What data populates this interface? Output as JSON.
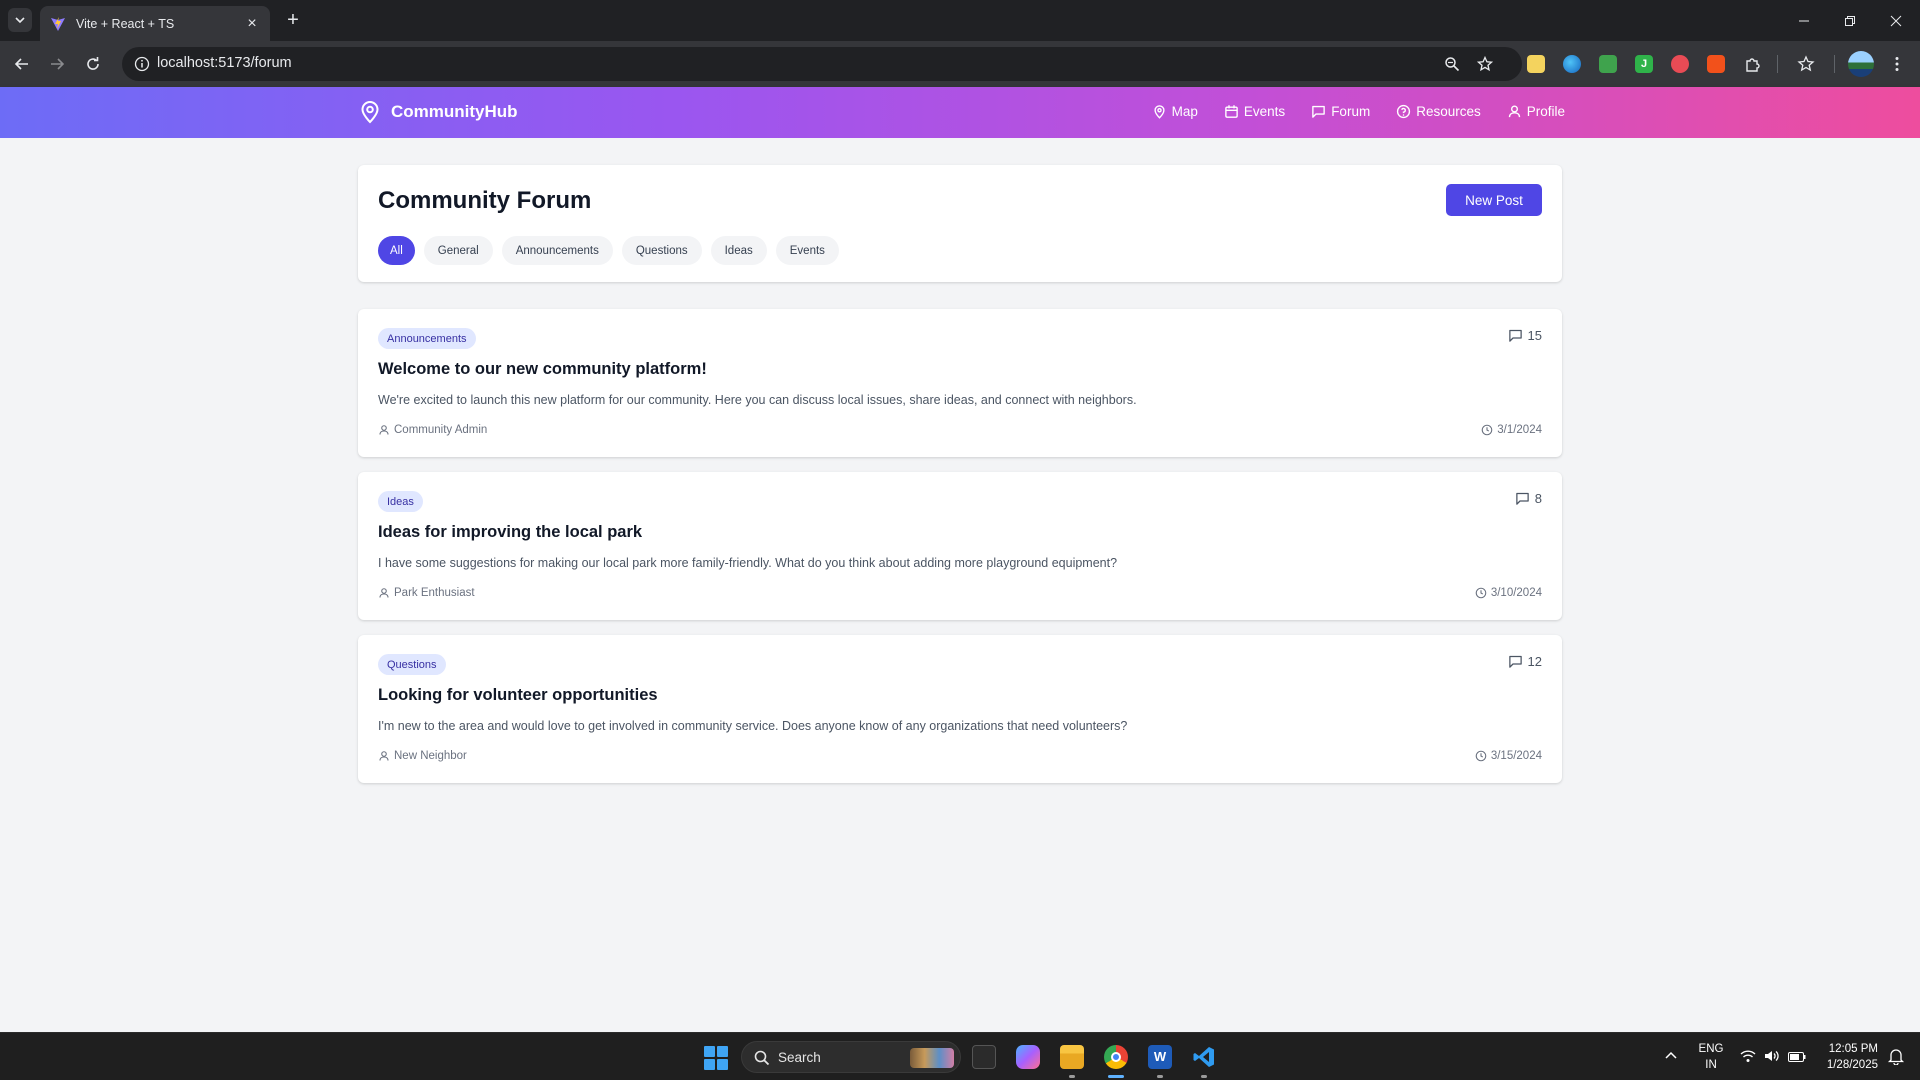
{
  "browser": {
    "tab_title": "Vite + React + TS",
    "url": "localhost:5173/forum"
  },
  "header": {
    "brand": "CommunityHub",
    "nav": [
      {
        "label": "Map",
        "icon": "map-pin-icon"
      },
      {
        "label": "Events",
        "icon": "calendar-icon"
      },
      {
        "label": "Forum",
        "icon": "message-square-icon"
      },
      {
        "label": "Resources",
        "icon": "help-circle-icon"
      },
      {
        "label": "Profile",
        "icon": "user-icon"
      }
    ]
  },
  "forum": {
    "title": "Community Forum",
    "new_post_label": "New Post",
    "categories": [
      "All",
      "General",
      "Announcements",
      "Questions",
      "Ideas",
      "Events"
    ],
    "active_category": "All",
    "posts": [
      {
        "category": "Announcements",
        "title": "Welcome to our new community platform!",
        "body": "We're excited to launch this new platform for our community. Here you can discuss local issues, share ideas, and connect with neighbors.",
        "author": "Community Admin",
        "date": "3/1/2024",
        "comments": "15"
      },
      {
        "category": "Ideas",
        "title": "Ideas for improving the local park",
        "body": "I have some suggestions for making our local park more family-friendly. What do you think about adding more playground equipment?",
        "author": "Park Enthusiast",
        "date": "3/10/2024",
        "comments": "8"
      },
      {
        "category": "Questions",
        "title": "Looking for volunteer opportunities",
        "body": "I'm new to the area and would love to get involved in community service. Does anyone know of any organizations that need volunteers?",
        "author": "New Neighbor",
        "date": "3/15/2024",
        "comments": "12"
      }
    ]
  },
  "taskbar": {
    "search_label": "Search",
    "lang_line1": "ENG",
    "lang_line2": "IN",
    "time": "12:05 PM",
    "date": "1/28/2025"
  },
  "colors": {
    "accent": "#4f46e5",
    "header_gradient_start": "#6d6cf6",
    "header_gradient_end": "#ee4d9e",
    "badge_bg": "#e0e7ff",
    "badge_text": "#3730a3"
  }
}
